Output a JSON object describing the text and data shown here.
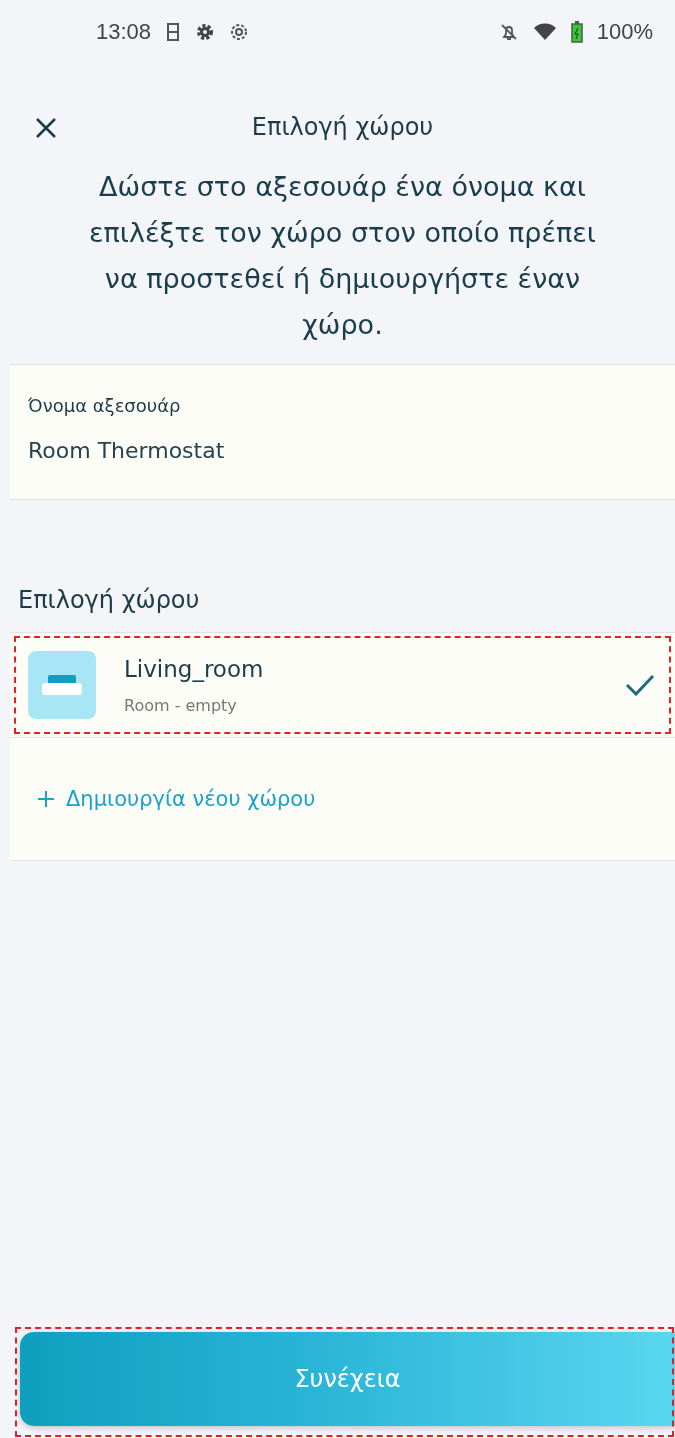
{
  "status_bar": {
    "time": "13:08",
    "battery": "100%"
  },
  "header": {
    "title": "Επιλογή χώρου"
  },
  "instruction": "Δώστε στο αξεσουάρ ένα όνομα και επιλέξτε τον χώρο στον οποίο πρέπει να προστεθεί ή δημιουργήστε έναν χώρο.",
  "name_field": {
    "label": "Όνομα αξεσουάρ",
    "value": "Room Thermostat"
  },
  "room_section": {
    "title": "Επιλογή χώρου",
    "rooms": [
      {
        "name": "Living_room",
        "subtitle": "Room - empty",
        "selected": true,
        "highlighted": true
      }
    ],
    "create_label": "Δημιουργία νέου χώρου"
  },
  "continue_button": {
    "label": "Συνέχεια",
    "highlighted": true
  }
}
